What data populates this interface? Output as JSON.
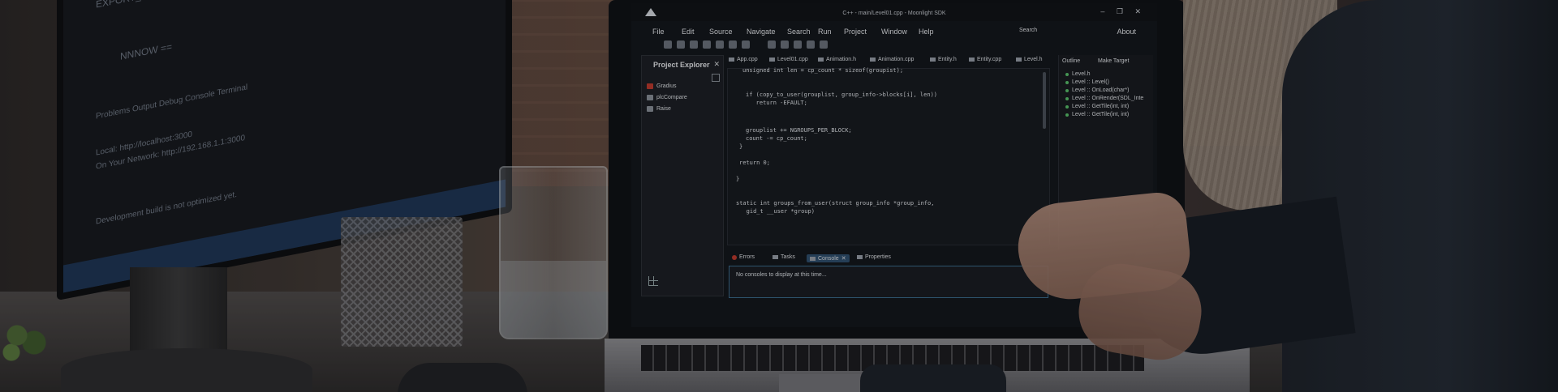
{
  "window": {
    "title": "C++ - main/Level01.cpp - Moonlight SDK",
    "controls": "– ❐ ✕"
  },
  "menu": {
    "items": [
      "File",
      "Edit",
      "Source",
      "Navigate",
      "Search",
      "Run",
      "Project",
      "Window",
      "Help"
    ],
    "search_label": "Search",
    "about": "About"
  },
  "project_explorer": {
    "title": "Project Explorer",
    "close": "✕",
    "items": [
      {
        "label": "Gradius",
        "icon": "project-red-icon"
      },
      {
        "label": "plcCompare",
        "icon": "folder-icon"
      },
      {
        "label": "Raise",
        "icon": "folder-icon"
      }
    ]
  },
  "editor": {
    "tabs": [
      "App.cpp",
      "Level01.cpp",
      "Animation.h",
      "Animation.cpp",
      "Entity.h",
      "Entity.cpp",
      "Level.h"
    ],
    "close": "✕",
    "code": [
      "unsigned int len = cp_count * sizeof(groupist);",
      "",
      "if (copy_to_user(grouplist, group_info->blocks[i], len))",
      "   return -EFAULT;",
      "",
      "",
      "grouplist += NGROUPS_PER_BLOCK;",
      "count -= cp_count;",
      "}",
      "",
      "return 0;",
      "",
      "}",
      "",
      "",
      "static int groups_from_user(struct group_info *group_info,",
      "   gid_t __user *group)"
    ]
  },
  "outline": {
    "tab_outline": "Outline",
    "tab_make": "Make Target",
    "items": [
      "Level.h",
      "Level :: Level()",
      "Level :: OnLoad(char*)",
      "Level :: OnRender(SDL_Inte",
      "Level :: GetTile(int, int)",
      "Level :: GetTile(int, int)"
    ]
  },
  "bottom_panel": {
    "tabs": [
      "Errors",
      "Tasks",
      "Console",
      "Properties"
    ],
    "active_tab": "Console",
    "close": "✕",
    "console_message": "No consoles to display at this time..."
  },
  "left_monitor": {
    "lines": [
      "EXPORT_SYMBOL(groups_free);",
      "NNNOW ==",
      "Problems   Output   Debug Console   Terminal",
      "Local: http://localhost:3000",
      "On Your Network: http://192.168.1.1:3000",
      "Development build is not optimized yet."
    ]
  },
  "colors": {
    "accent_blue": "#2e4f6e",
    "red_icon": "#c0392b",
    "green_dot": "#59c36a"
  }
}
